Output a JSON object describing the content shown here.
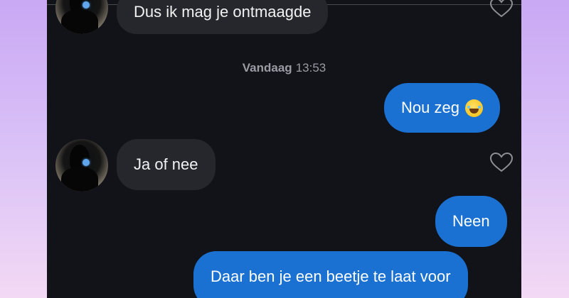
{
  "chat": {
    "messages": [
      {
        "sender": "other",
        "text": "Dus ik mag je ontmaagde"
      },
      {
        "sender": "other",
        "text": "Ja of nee"
      },
      {
        "sender": "self",
        "text": "Nou zeg",
        "emoji": "face-with-tears-of-joy"
      },
      {
        "sender": "self",
        "text": "Neen"
      },
      {
        "sender": "self",
        "text": "Daar ben je een beetje te laat voor"
      }
    ],
    "timestamp": {
      "day": "Vandaag",
      "time": "13:53"
    }
  },
  "colors": {
    "background_frame": "#d3b7f6",
    "chat_background": "#121319",
    "incoming_bubble": "#26272d",
    "outgoing_bubble": "#1a71d2",
    "timestamp_text": "#9a9ba3"
  },
  "icons": {
    "like": "heart-outline-icon",
    "avatar": "profile-avatar"
  }
}
